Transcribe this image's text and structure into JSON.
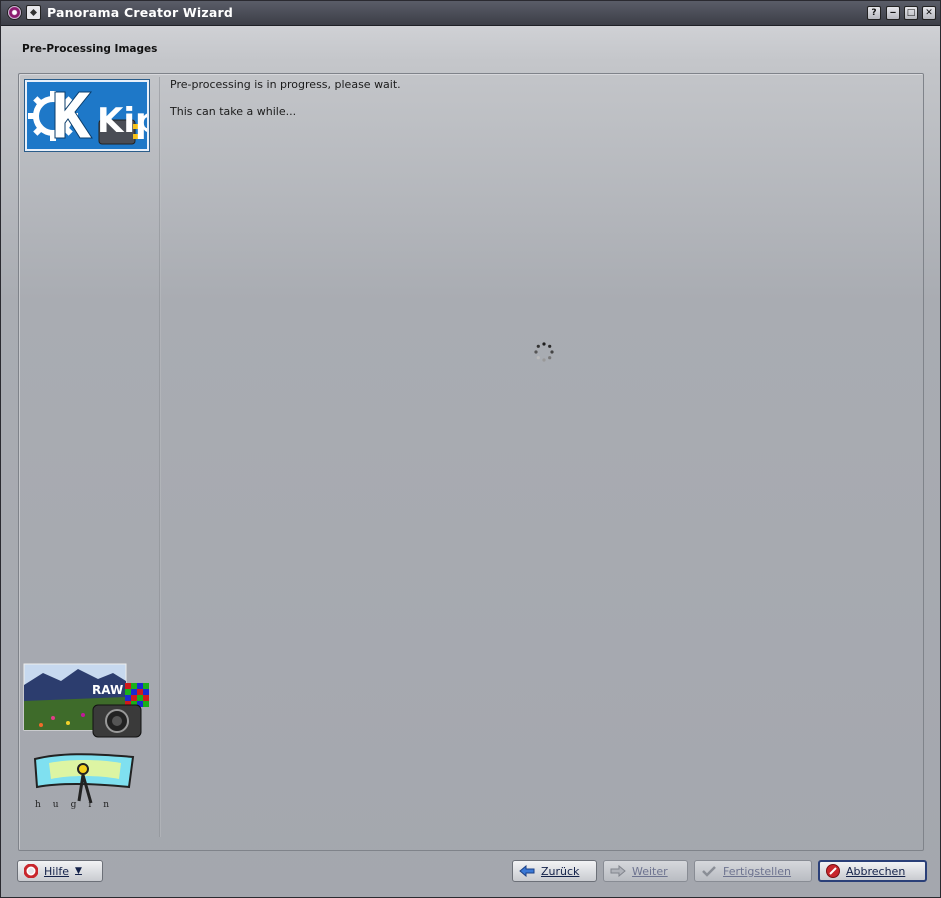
{
  "window": {
    "title": "Panorama Creator Wizard",
    "controls": {
      "help": "?",
      "minimize": "‒",
      "maximize": "□",
      "close": "✕"
    }
  },
  "page": {
    "heading": "Pre-Processing Images",
    "message_line1": "Pre-processing is in progress, please wait.",
    "message_line2": "This can take a while..."
  },
  "logos": {
    "kipi": "Kipi",
    "raw": "RAW"
  },
  "footer": {
    "help_label": "Hilfe",
    "back_label": "Zurück",
    "next_label": "Weiter",
    "finish_label": "Fertigstellen",
    "cancel_label": "Abbrechen"
  },
  "colors": {
    "accent": "#1e78c8",
    "titlebar": "#4a4c56",
    "cancel_icon": "#c8262c"
  }
}
